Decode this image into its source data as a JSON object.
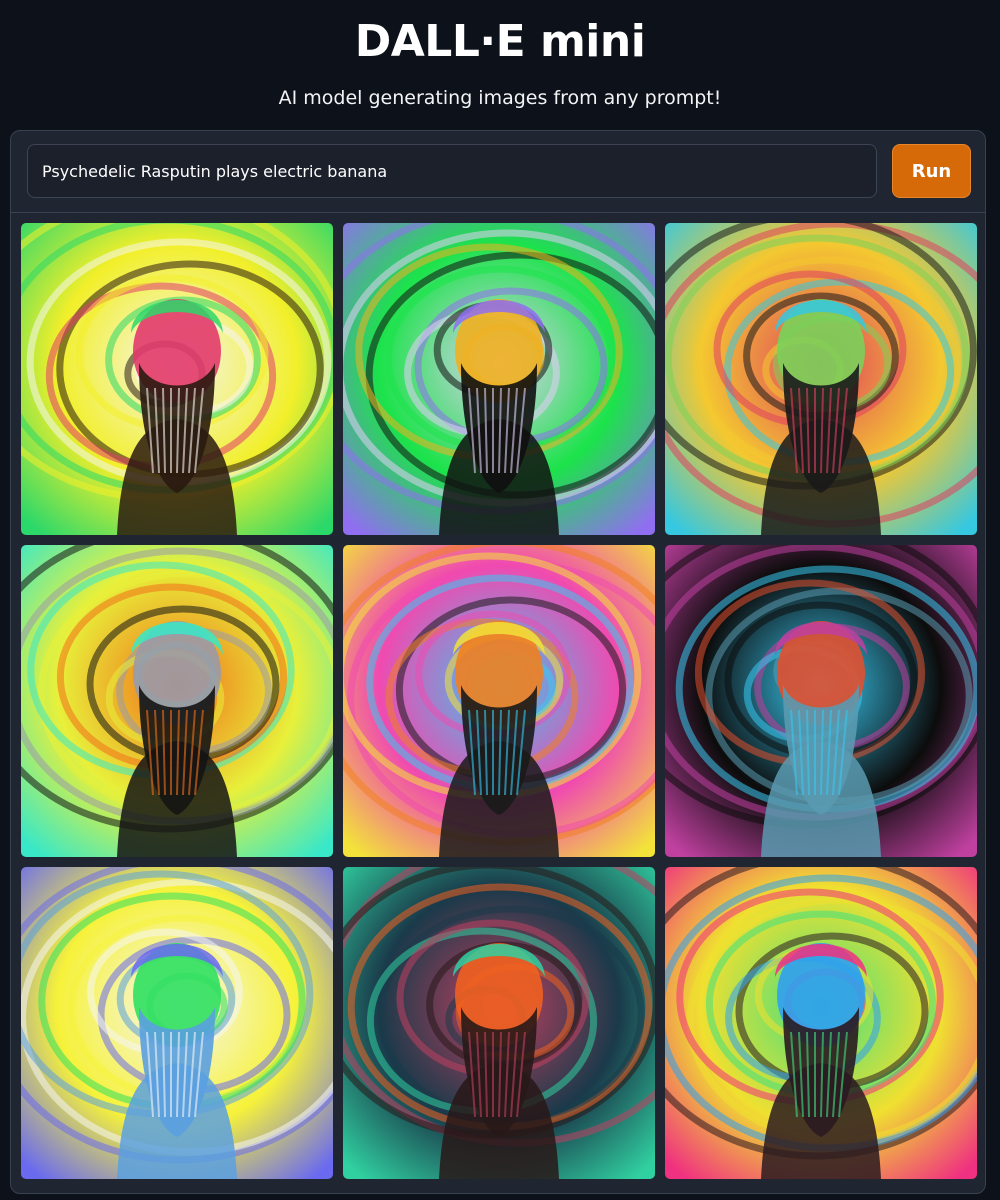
{
  "header": {
    "title": "DALL·E mini",
    "subtitle": "AI model generating images from any prompt!"
  },
  "prompt": {
    "value": "Psychedelic Rasputin plays electric banana",
    "run_label": "Run"
  },
  "colors": {
    "background": "#0d1119",
    "panel": "#1f2531",
    "accent": "#d66a08"
  },
  "gallery": {
    "images": [
      {
        "name": "generated-image-1",
        "palette": [
          "#f2ef2a",
          "#2bd86a",
          "#f6f6f0",
          "#2a1a10",
          "#e23a6b"
        ]
      },
      {
        "name": "generated-image-2",
        "palette": [
          "#1be34a",
          "#8f6ff0",
          "#e2d0f5",
          "#101010",
          "#f0b020"
        ]
      },
      {
        "name": "generated-image-3",
        "palette": [
          "#f4c830",
          "#35c8e0",
          "#e04060",
          "#1a1a1a",
          "#7ad15a"
        ]
      },
      {
        "name": "generated-image-4",
        "palette": [
          "#e8f03a",
          "#38e8c8",
          "#f0701a",
          "#141414",
          "#9a9aa8"
        ]
      },
      {
        "name": "generated-image-5",
        "palette": [
          "#f04ab0",
          "#f2e23a",
          "#38c8f0",
          "#1a1a1a",
          "#f08020"
        ]
      },
      {
        "name": "generated-image-6",
        "palette": [
          "#0c0c0c",
          "#c040a0",
          "#38c8f0",
          "#5a9ab0",
          "#e05030"
        ]
      },
      {
        "name": "generated-image-7",
        "palette": [
          "#f6f23a",
          "#6a6af0",
          "#f6f6f6",
          "#5aa0e0",
          "#30e060"
        ]
      },
      {
        "name": "generated-image-8",
        "palette": [
          "#1a3a4a",
          "#30d0a0",
          "#c04060",
          "#281818",
          "#f06020"
        ]
      },
      {
        "name": "generated-image-9",
        "palette": [
          "#f0e030",
          "#f03080",
          "#40e080",
          "#2a1a20",
          "#30a0f0"
        ]
      }
    ]
  }
}
